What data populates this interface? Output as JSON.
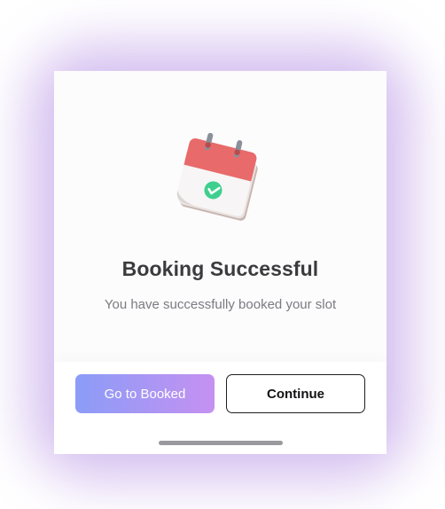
{
  "dialog": {
    "illustration": "calendar-check-icon",
    "title": "Booking Successful",
    "message": "You have successfully booked your slot"
  },
  "actions": {
    "primary_label": "Go to Booked",
    "secondary_label": "Continue"
  },
  "colors": {
    "primary_gradient_start": "#8b9cf7",
    "primary_gradient_end": "#c591f1",
    "glow": "#a06edc",
    "calendar_red": "#e86a6a",
    "check_green": "#3ecf8e"
  }
}
